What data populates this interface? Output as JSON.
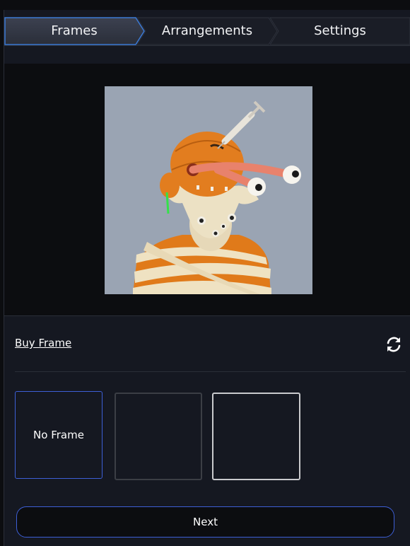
{
  "stepper": {
    "steps": [
      {
        "label": "Frames",
        "active": true
      },
      {
        "label": "Arrangements",
        "active": false
      },
      {
        "label": "Settings",
        "active": false
      }
    ]
  },
  "actions": {
    "buy_frame_label": "Buy Frame",
    "refresh_icon": "refresh-icon"
  },
  "frames": {
    "options": [
      {
        "label": "No Frame",
        "selected": true
      },
      {
        "label": "",
        "style": "dark"
      },
      {
        "label": "",
        "style": "silver"
      }
    ]
  },
  "footer": {
    "next_label": "Next"
  },
  "colors": {
    "accent": "#3d5fd6",
    "panel_bg": "#151821",
    "page_bg": "#0c0d10"
  }
}
